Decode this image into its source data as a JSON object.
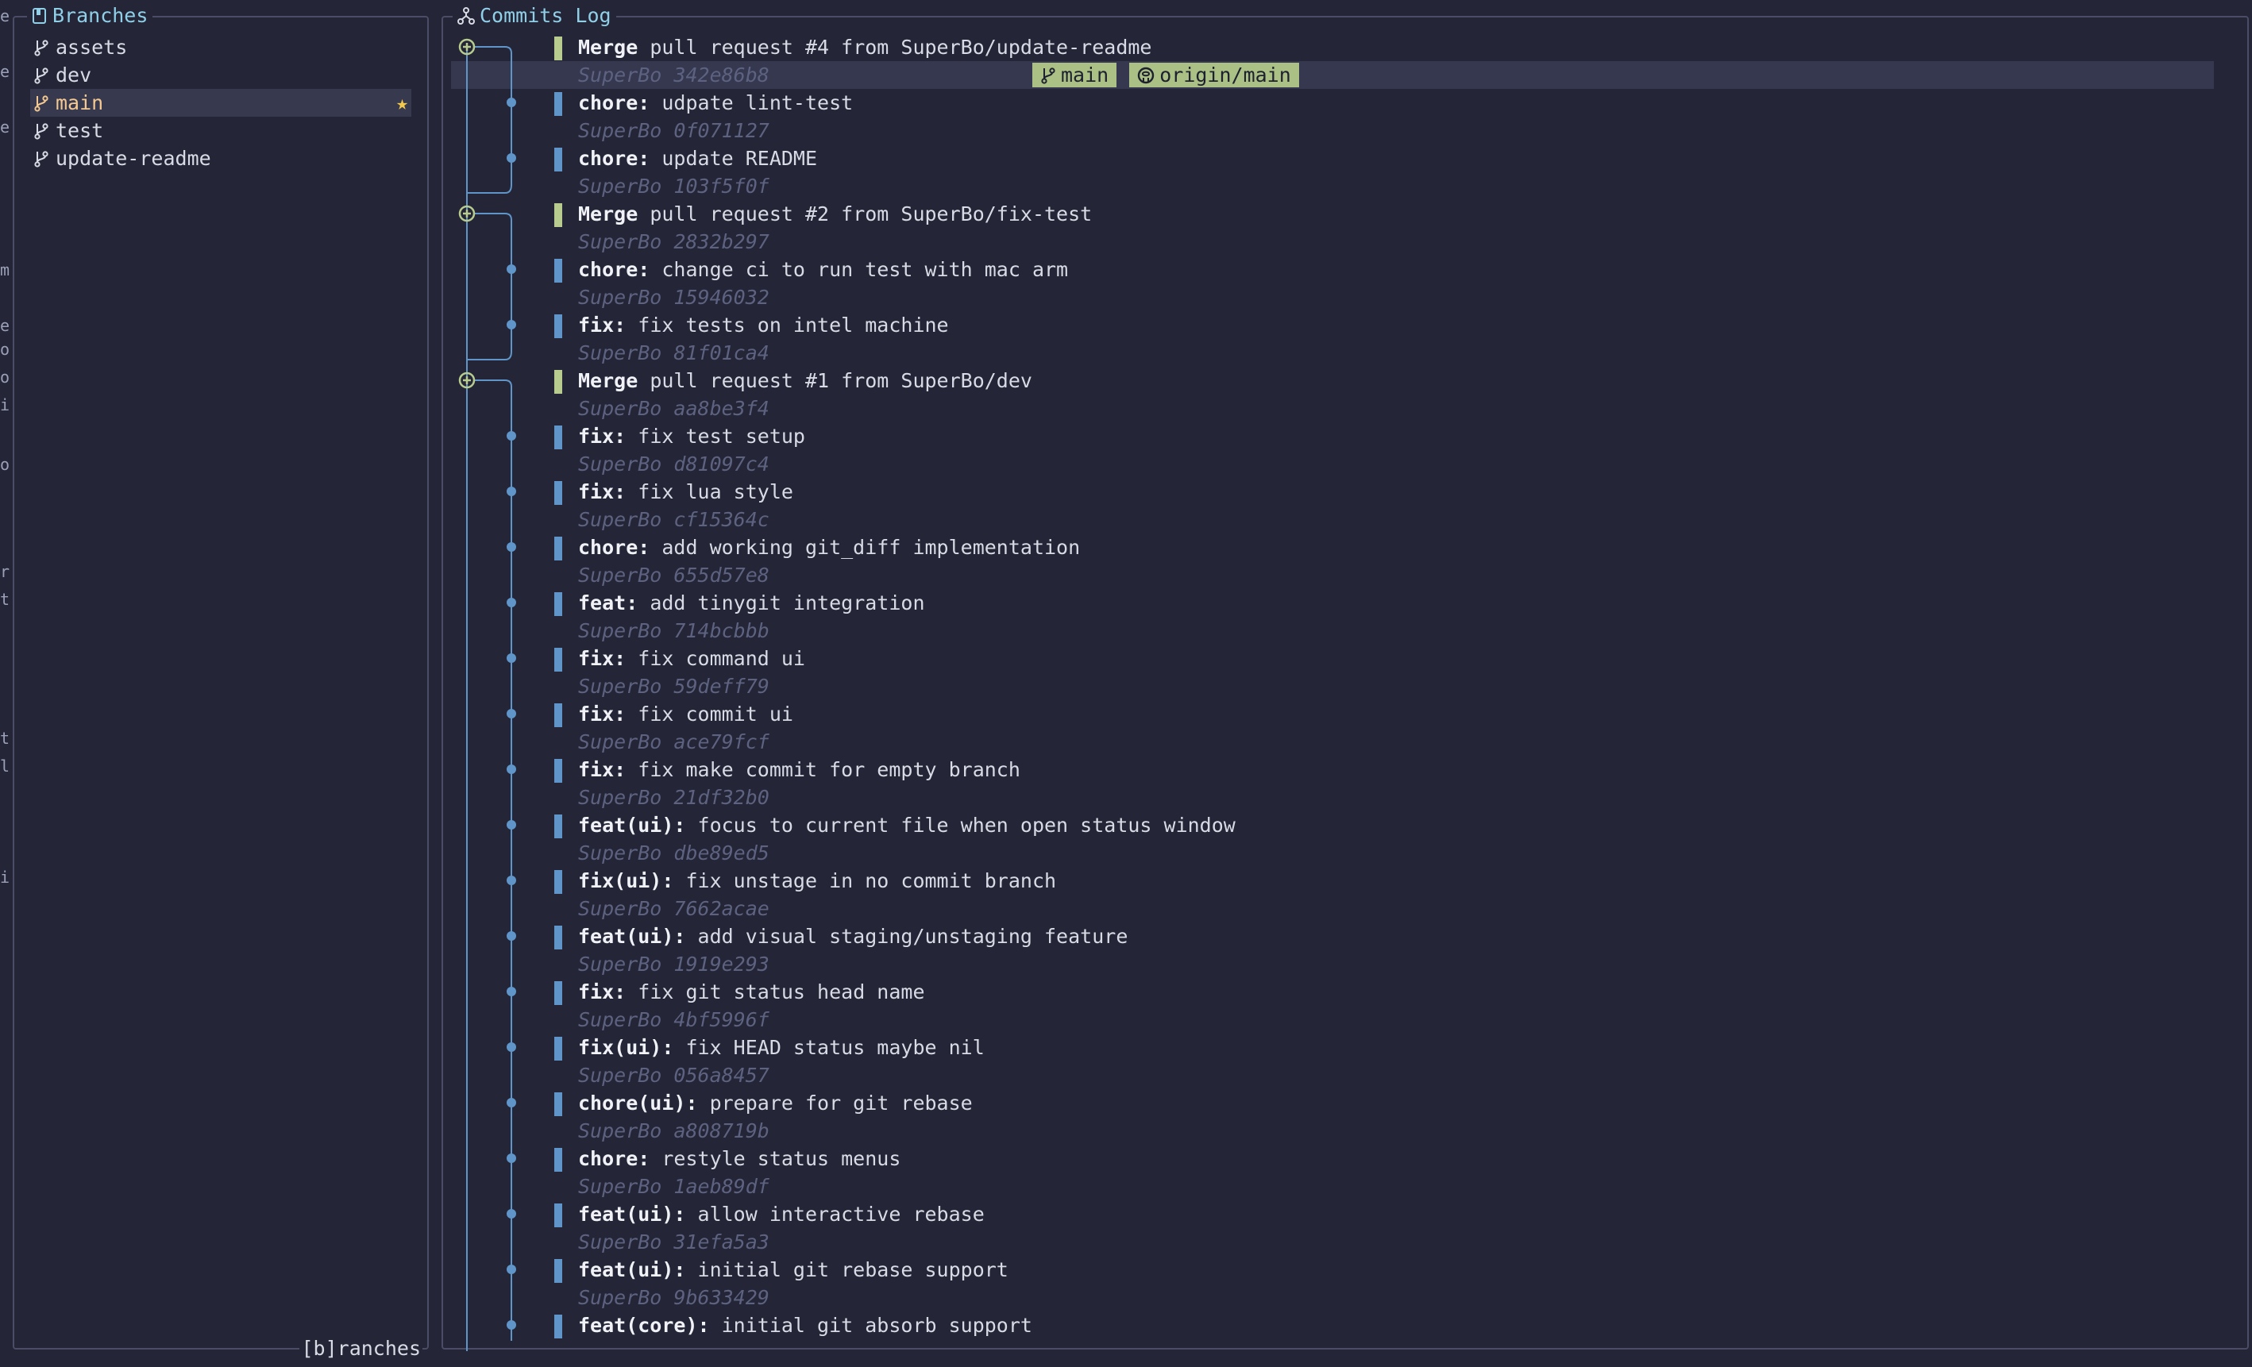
{
  "left_edge_glyphs": [
    "e",
    "e",
    "e",
    "m",
    "e",
    "o",
    "o",
    "i",
    "o",
    "r",
    "t",
    "t",
    "l",
    "i"
  ],
  "branches_panel": {
    "title": "Branches",
    "title_icon": "book-icon",
    "footer": "[b]ranches",
    "items": [
      {
        "label": "assets",
        "icon": "git-branch-icon"
      },
      {
        "label": "dev",
        "icon": "git-branch-icon"
      },
      {
        "label": "main",
        "icon": "git-branch-edit-icon",
        "current": true,
        "badge_icon": "star-icon"
      },
      {
        "label": "test",
        "icon": "git-branch-icon"
      },
      {
        "label": "update-readme",
        "icon": "git-branch-icon"
      }
    ]
  },
  "commits_panel": {
    "title": "Commits Log",
    "title_icon": "git-fork-icon",
    "commits": [
      {
        "prefix": "Merge",
        "message": " pull request #4 from SuperBo/update-readme",
        "author": "SuperBo",
        "hash": "342e86b8",
        "merge": true,
        "selected": true,
        "refs": [
          {
            "label": "main",
            "icon": "git-branch-icon"
          },
          {
            "label": "origin/main",
            "icon": "github-icon"
          }
        ]
      },
      {
        "prefix": "chore:",
        "message": " udpate lint-test",
        "author": "SuperBo",
        "hash": "0f071127"
      },
      {
        "prefix": "chore:",
        "message": " update README",
        "author": "SuperBo",
        "hash": "103f5f0f"
      },
      {
        "prefix": "Merge",
        "message": " pull request #2 from SuperBo/fix-test",
        "author": "SuperBo",
        "hash": "2832b297",
        "merge": true
      },
      {
        "prefix": "chore:",
        "message": " change ci to run test with mac arm",
        "author": "SuperBo",
        "hash": "15946032"
      },
      {
        "prefix": "fix:",
        "message": " fix tests on intel machine",
        "author": "SuperBo",
        "hash": "81f01ca4"
      },
      {
        "prefix": "Merge",
        "message": " pull request #1 from SuperBo/dev",
        "author": "SuperBo",
        "hash": "aa8be3f4",
        "merge": true
      },
      {
        "prefix": "fix:",
        "message": " fix test setup",
        "author": "SuperBo",
        "hash": "d81097c4"
      },
      {
        "prefix": "fix:",
        "message": " fix lua style",
        "author": "SuperBo",
        "hash": "cf15364c"
      },
      {
        "prefix": "chore:",
        "message": " add working git_diff implementation",
        "author": "SuperBo",
        "hash": "655d57e8"
      },
      {
        "prefix": "feat:",
        "message": " add tinygit integration",
        "author": "SuperBo",
        "hash": "714bcbbb"
      },
      {
        "prefix": "fix:",
        "message": " fix command ui",
        "author": "SuperBo",
        "hash": "59deff79"
      },
      {
        "prefix": "fix:",
        "message": " fix commit ui",
        "author": "SuperBo",
        "hash": "ace79fcf"
      },
      {
        "prefix": "fix:",
        "message": " fix make commit for empty branch",
        "author": "SuperBo",
        "hash": "21df32b0"
      },
      {
        "prefix": "feat(ui):",
        "message": " focus to current file when open status window",
        "author": "SuperBo",
        "hash": "dbe89ed5"
      },
      {
        "prefix": "fix(ui):",
        "message": " fix unstage in no commit branch",
        "author": "SuperBo",
        "hash": "7662acae"
      },
      {
        "prefix": "feat(ui):",
        "message": " add visual staging/unstaging feature",
        "author": "SuperBo",
        "hash": "1919e293"
      },
      {
        "prefix": "fix:",
        "message": " fix git status head name",
        "author": "SuperBo",
        "hash": "4bf5996f"
      },
      {
        "prefix": "fix(ui):",
        "message": " fix HEAD status maybe nil",
        "author": "SuperBo",
        "hash": "056a8457"
      },
      {
        "prefix": "chore(ui):",
        "message": " prepare for git rebase",
        "author": "SuperBo",
        "hash": "a808719b"
      },
      {
        "prefix": "chore:",
        "message": " restyle status menus",
        "author": "SuperBo",
        "hash": "1aeb89df"
      },
      {
        "prefix": "feat(ui):",
        "message": " allow interactive rebase",
        "author": "SuperBo",
        "hash": "31efa5a3"
      },
      {
        "prefix": "feat(ui):",
        "message": " initial git rebase support",
        "author": "SuperBo",
        "hash": "9b633429"
      },
      {
        "prefix": "feat(core):",
        "message": " initial git absorb support",
        "author": "",
        "hash": ""
      }
    ]
  },
  "colors": {
    "background": "#242536",
    "border": "#4a4d65",
    "title": "#8fd0e8",
    "current_branch": "#f3c891",
    "commit_bar": "#5f95c9",
    "merge_bar": "#b7cc8e",
    "ref_badge": "#aac085",
    "graph": "#5f95c9",
    "star": "#f2c94c"
  }
}
